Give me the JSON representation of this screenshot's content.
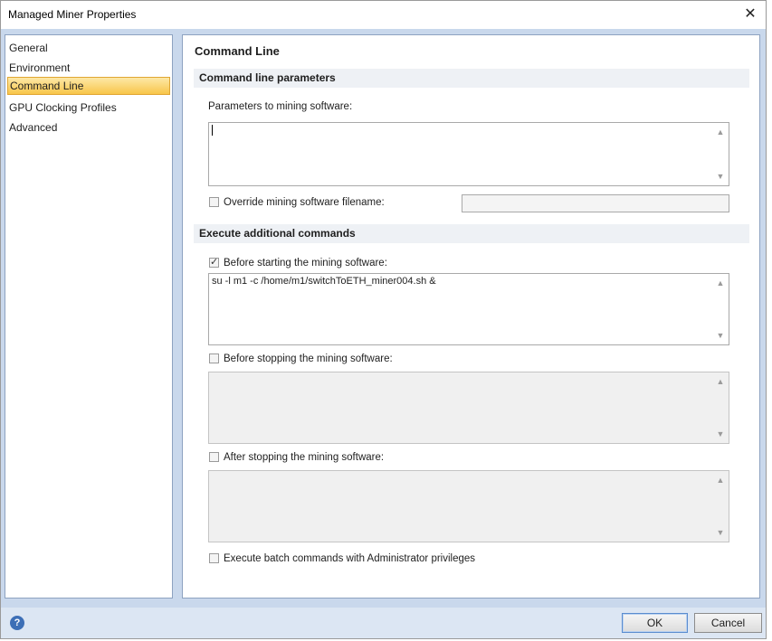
{
  "window": {
    "title": "Managed Miner Properties"
  },
  "nav": {
    "items": [
      {
        "label": "General",
        "active": false
      },
      {
        "label": "Environment",
        "active": false
      },
      {
        "label": "Command Line",
        "active": true
      },
      {
        "label": "GPU Clocking Profiles",
        "active": false
      },
      {
        "label": "Advanced",
        "active": false
      }
    ]
  },
  "content": {
    "title": "Command Line",
    "section_params": "Command line parameters",
    "params_label": "Parameters to mining software:",
    "params_value": "",
    "override_label": "Override mining software filename:",
    "override_checked": false,
    "override_value": "",
    "section_exec": "Execute additional commands",
    "before_start_label": "Before starting the mining software:",
    "before_start_checked": true,
    "before_start_value": "su -l m1 -c /home/m1/switchToETH_miner004.sh &",
    "before_stop_label": "Before stopping the mining software:",
    "before_stop_checked": false,
    "before_stop_value": "",
    "after_stop_label": "After stopping the mining software:",
    "after_stop_checked": false,
    "after_stop_value": "",
    "batch_label": "Execute batch commands with Administrator privileges",
    "batch_checked": false
  },
  "footer": {
    "help_glyph": "?",
    "ok_label": "OK",
    "cancel_label": "Cancel"
  },
  "colors": {
    "accent": "#f8c64a",
    "frame": "#c9d8ec",
    "help": "#3d6fb6"
  }
}
